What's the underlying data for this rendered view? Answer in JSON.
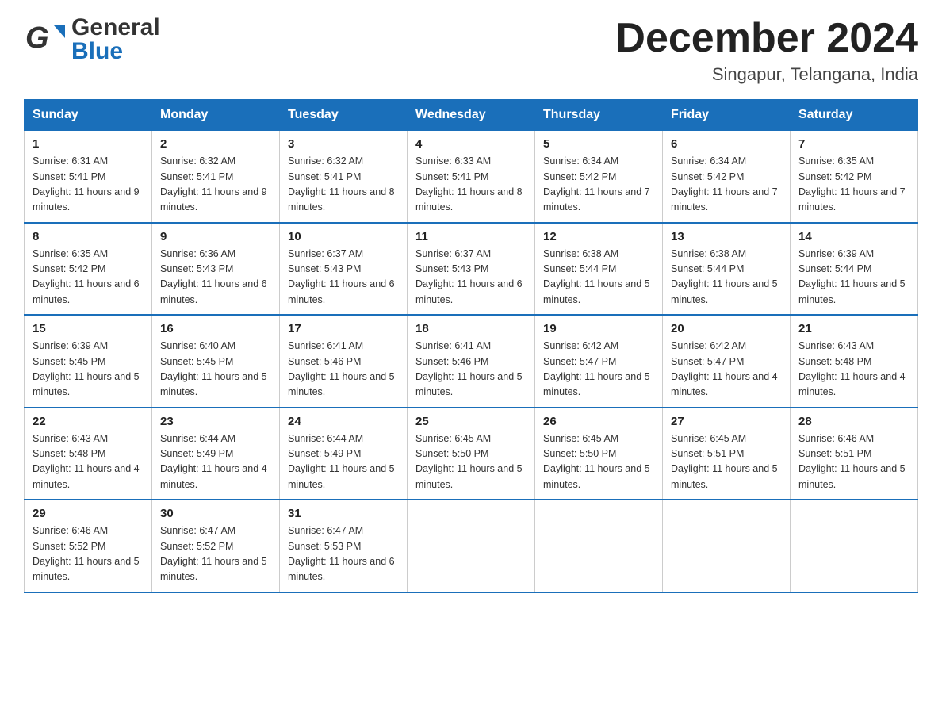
{
  "header": {
    "month_title": "December 2024",
    "location": "Singapur, Telangana, India"
  },
  "days_of_week": [
    "Sunday",
    "Monday",
    "Tuesday",
    "Wednesday",
    "Thursday",
    "Friday",
    "Saturday"
  ],
  "weeks": [
    [
      {
        "day": "1",
        "sunrise": "6:31 AM",
        "sunset": "5:41 PM",
        "daylight": "11 hours and 9 minutes."
      },
      {
        "day": "2",
        "sunrise": "6:32 AM",
        "sunset": "5:41 PM",
        "daylight": "11 hours and 9 minutes."
      },
      {
        "day": "3",
        "sunrise": "6:32 AM",
        "sunset": "5:41 PM",
        "daylight": "11 hours and 8 minutes."
      },
      {
        "day": "4",
        "sunrise": "6:33 AM",
        "sunset": "5:41 PM",
        "daylight": "11 hours and 8 minutes."
      },
      {
        "day": "5",
        "sunrise": "6:34 AM",
        "sunset": "5:42 PM",
        "daylight": "11 hours and 7 minutes."
      },
      {
        "day": "6",
        "sunrise": "6:34 AM",
        "sunset": "5:42 PM",
        "daylight": "11 hours and 7 minutes."
      },
      {
        "day": "7",
        "sunrise": "6:35 AM",
        "sunset": "5:42 PM",
        "daylight": "11 hours and 7 minutes."
      }
    ],
    [
      {
        "day": "8",
        "sunrise": "6:35 AM",
        "sunset": "5:42 PM",
        "daylight": "11 hours and 6 minutes."
      },
      {
        "day": "9",
        "sunrise": "6:36 AM",
        "sunset": "5:43 PM",
        "daylight": "11 hours and 6 minutes."
      },
      {
        "day": "10",
        "sunrise": "6:37 AM",
        "sunset": "5:43 PM",
        "daylight": "11 hours and 6 minutes."
      },
      {
        "day": "11",
        "sunrise": "6:37 AM",
        "sunset": "5:43 PM",
        "daylight": "11 hours and 6 minutes."
      },
      {
        "day": "12",
        "sunrise": "6:38 AM",
        "sunset": "5:44 PM",
        "daylight": "11 hours and 5 minutes."
      },
      {
        "day": "13",
        "sunrise": "6:38 AM",
        "sunset": "5:44 PM",
        "daylight": "11 hours and 5 minutes."
      },
      {
        "day": "14",
        "sunrise": "6:39 AM",
        "sunset": "5:44 PM",
        "daylight": "11 hours and 5 minutes."
      }
    ],
    [
      {
        "day": "15",
        "sunrise": "6:39 AM",
        "sunset": "5:45 PM",
        "daylight": "11 hours and 5 minutes."
      },
      {
        "day": "16",
        "sunrise": "6:40 AM",
        "sunset": "5:45 PM",
        "daylight": "11 hours and 5 minutes."
      },
      {
        "day": "17",
        "sunrise": "6:41 AM",
        "sunset": "5:46 PM",
        "daylight": "11 hours and 5 minutes."
      },
      {
        "day": "18",
        "sunrise": "6:41 AM",
        "sunset": "5:46 PM",
        "daylight": "11 hours and 5 minutes."
      },
      {
        "day": "19",
        "sunrise": "6:42 AM",
        "sunset": "5:47 PM",
        "daylight": "11 hours and 5 minutes."
      },
      {
        "day": "20",
        "sunrise": "6:42 AM",
        "sunset": "5:47 PM",
        "daylight": "11 hours and 4 minutes."
      },
      {
        "day": "21",
        "sunrise": "6:43 AM",
        "sunset": "5:48 PM",
        "daylight": "11 hours and 4 minutes."
      }
    ],
    [
      {
        "day": "22",
        "sunrise": "6:43 AM",
        "sunset": "5:48 PM",
        "daylight": "11 hours and 4 minutes."
      },
      {
        "day": "23",
        "sunrise": "6:44 AM",
        "sunset": "5:49 PM",
        "daylight": "11 hours and 4 minutes."
      },
      {
        "day": "24",
        "sunrise": "6:44 AM",
        "sunset": "5:49 PM",
        "daylight": "11 hours and 5 minutes."
      },
      {
        "day": "25",
        "sunrise": "6:45 AM",
        "sunset": "5:50 PM",
        "daylight": "11 hours and 5 minutes."
      },
      {
        "day": "26",
        "sunrise": "6:45 AM",
        "sunset": "5:50 PM",
        "daylight": "11 hours and 5 minutes."
      },
      {
        "day": "27",
        "sunrise": "6:45 AM",
        "sunset": "5:51 PM",
        "daylight": "11 hours and 5 minutes."
      },
      {
        "day": "28",
        "sunrise": "6:46 AM",
        "sunset": "5:51 PM",
        "daylight": "11 hours and 5 minutes."
      }
    ],
    [
      {
        "day": "29",
        "sunrise": "6:46 AM",
        "sunset": "5:52 PM",
        "daylight": "11 hours and 5 minutes."
      },
      {
        "day": "30",
        "sunrise": "6:47 AM",
        "sunset": "5:52 PM",
        "daylight": "11 hours and 5 minutes."
      },
      {
        "day": "31",
        "sunrise": "6:47 AM",
        "sunset": "5:53 PM",
        "daylight": "11 hours and 6 minutes."
      },
      null,
      null,
      null,
      null
    ]
  ]
}
